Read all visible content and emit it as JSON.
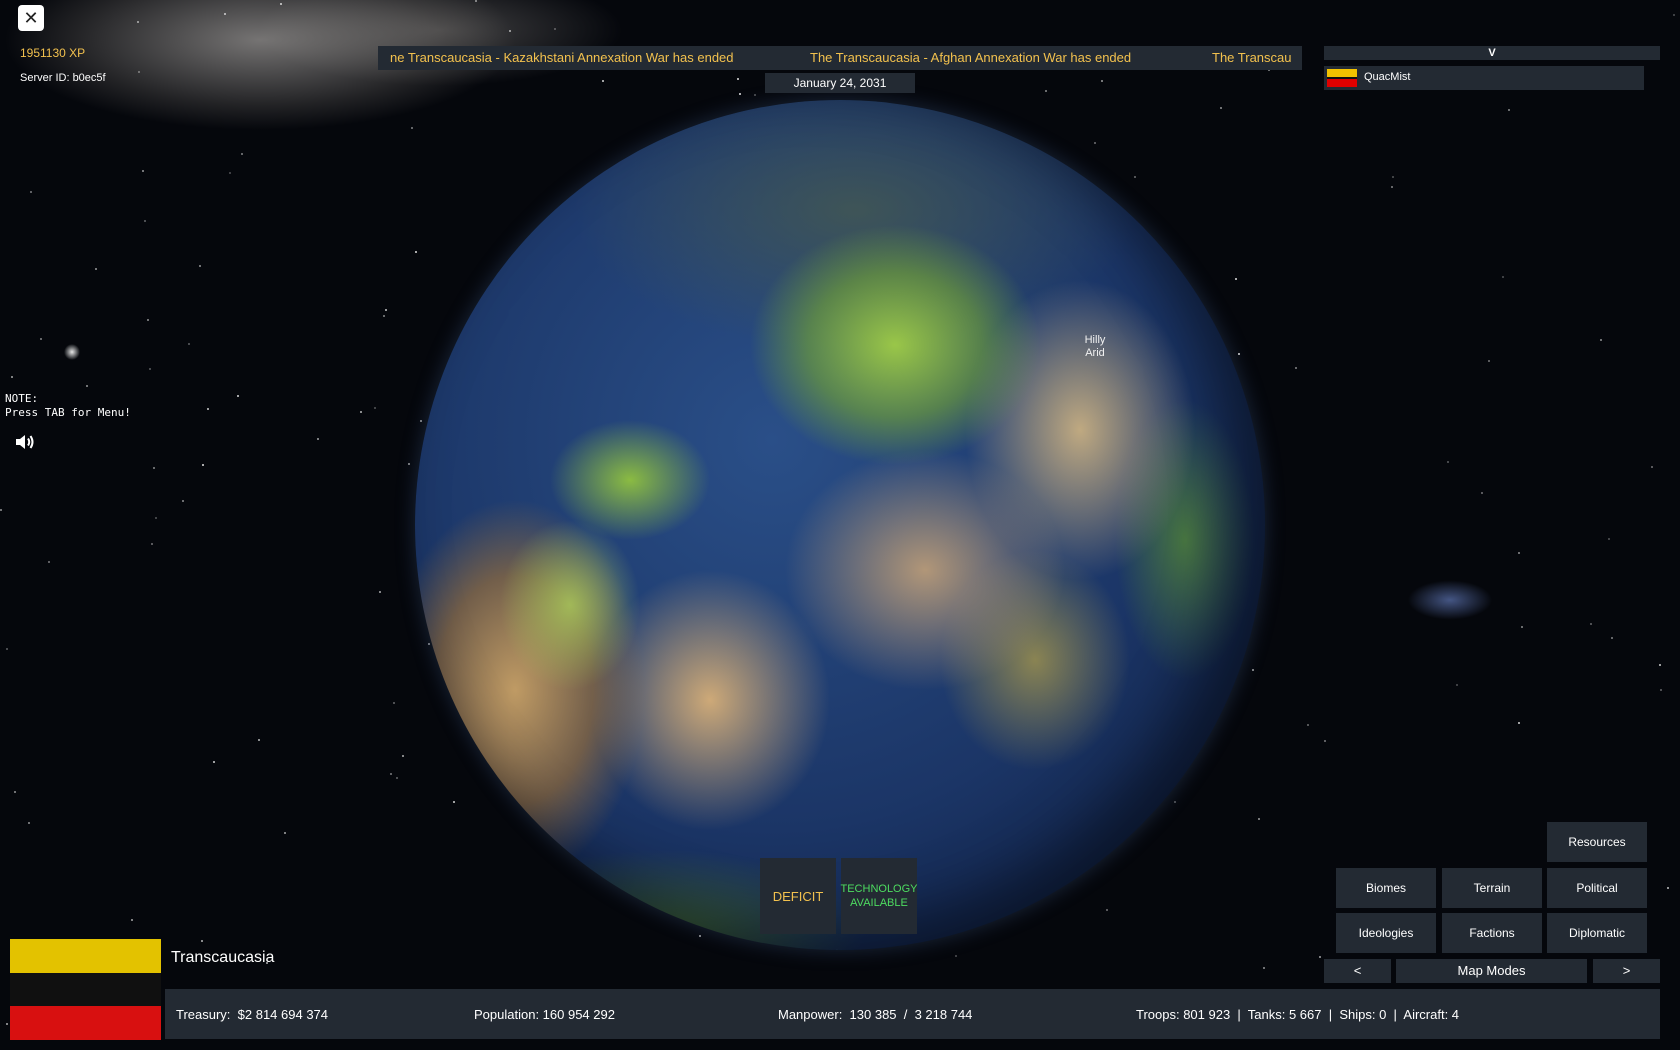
{
  "player": {
    "xp": "1951130 XP",
    "server_id": "Server ID: b0ec5f"
  },
  "note": {
    "line1": "NOTE:",
    "line2": "Press TAB for Menu!"
  },
  "ticker": {
    "messages": [
      "ne Transcaucasia - Kazakhstani Annexation War has ended",
      "The Transcaucasia - Afghan Annexation War has ended",
      "The Transcau"
    ]
  },
  "date": "January 24, 2031",
  "player_list": {
    "header": "V",
    "players": [
      {
        "name": "QuacMist",
        "flag_colors": [
          "#f2c200",
          "#111111",
          "#e00000"
        ]
      }
    ]
  },
  "map": {
    "hover_label_line1": "Hilly",
    "hover_label_line2": "Arid"
  },
  "notices": {
    "deficit": "DEFICIT",
    "technology_line1": "TECHNOLOGY",
    "technology_line2": "AVAILABLE"
  },
  "map_modes": {
    "resources": "Resources",
    "biomes": "Biomes",
    "terrain": "Terrain",
    "political": "Political",
    "ideologies": "Ideologies",
    "factions": "Factions",
    "diplomatic": "Diplomatic",
    "prev": "<",
    "label": "Map Modes",
    "next": ">"
  },
  "country": {
    "name": "Transcaucasia",
    "flag_colors": [
      "#e3c200",
      "#101010",
      "#d81010"
    ]
  },
  "stats": {
    "treasury": "Treasury:  $2 814 694 374",
    "population": "Population: 160 954 292",
    "manpower": "Manpower:  130 385  /  3 218 744",
    "military": "Troops: 801 923  |  Tanks: 5 667  |  Ships: 0  |  Aircraft: 4"
  },
  "colors": {
    "panel": "#232a33",
    "accent_gold": "#f2c14e",
    "tech_green": "#4ddc60"
  },
  "icons": [
    "close-icon",
    "speaker-icon"
  ]
}
